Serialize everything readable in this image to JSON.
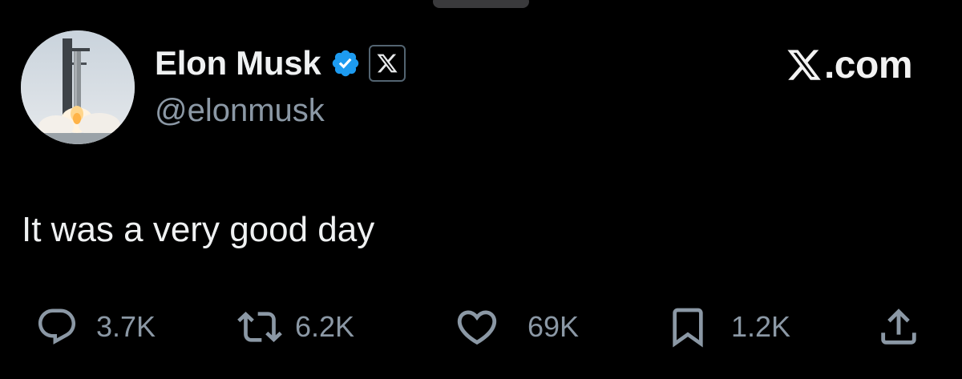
{
  "header": {
    "display_name": "Elon Musk",
    "handle": "@elonmusk",
    "verified_icon": "verified-badge-icon",
    "affiliate_icon": "x-logo-icon",
    "brand_text": ".com",
    "brand_icon": "x-logo-icon"
  },
  "tweet": {
    "text": "It was a very good day"
  },
  "actions": {
    "reply_count": "3.7K",
    "repost_count": "6.2K",
    "like_count": "69K",
    "bookmark_count": "1.2K",
    "reply_icon": "reply-icon",
    "repost_icon": "repost-icon",
    "like_icon": "heart-icon",
    "bookmark_icon": "bookmark-icon",
    "share_icon": "share-icon"
  },
  "colors": {
    "background": "#000000",
    "primary_text": "#e7e9ea",
    "secondary_text": "#8b98a5",
    "verified_blue": "#1d9bf0"
  }
}
